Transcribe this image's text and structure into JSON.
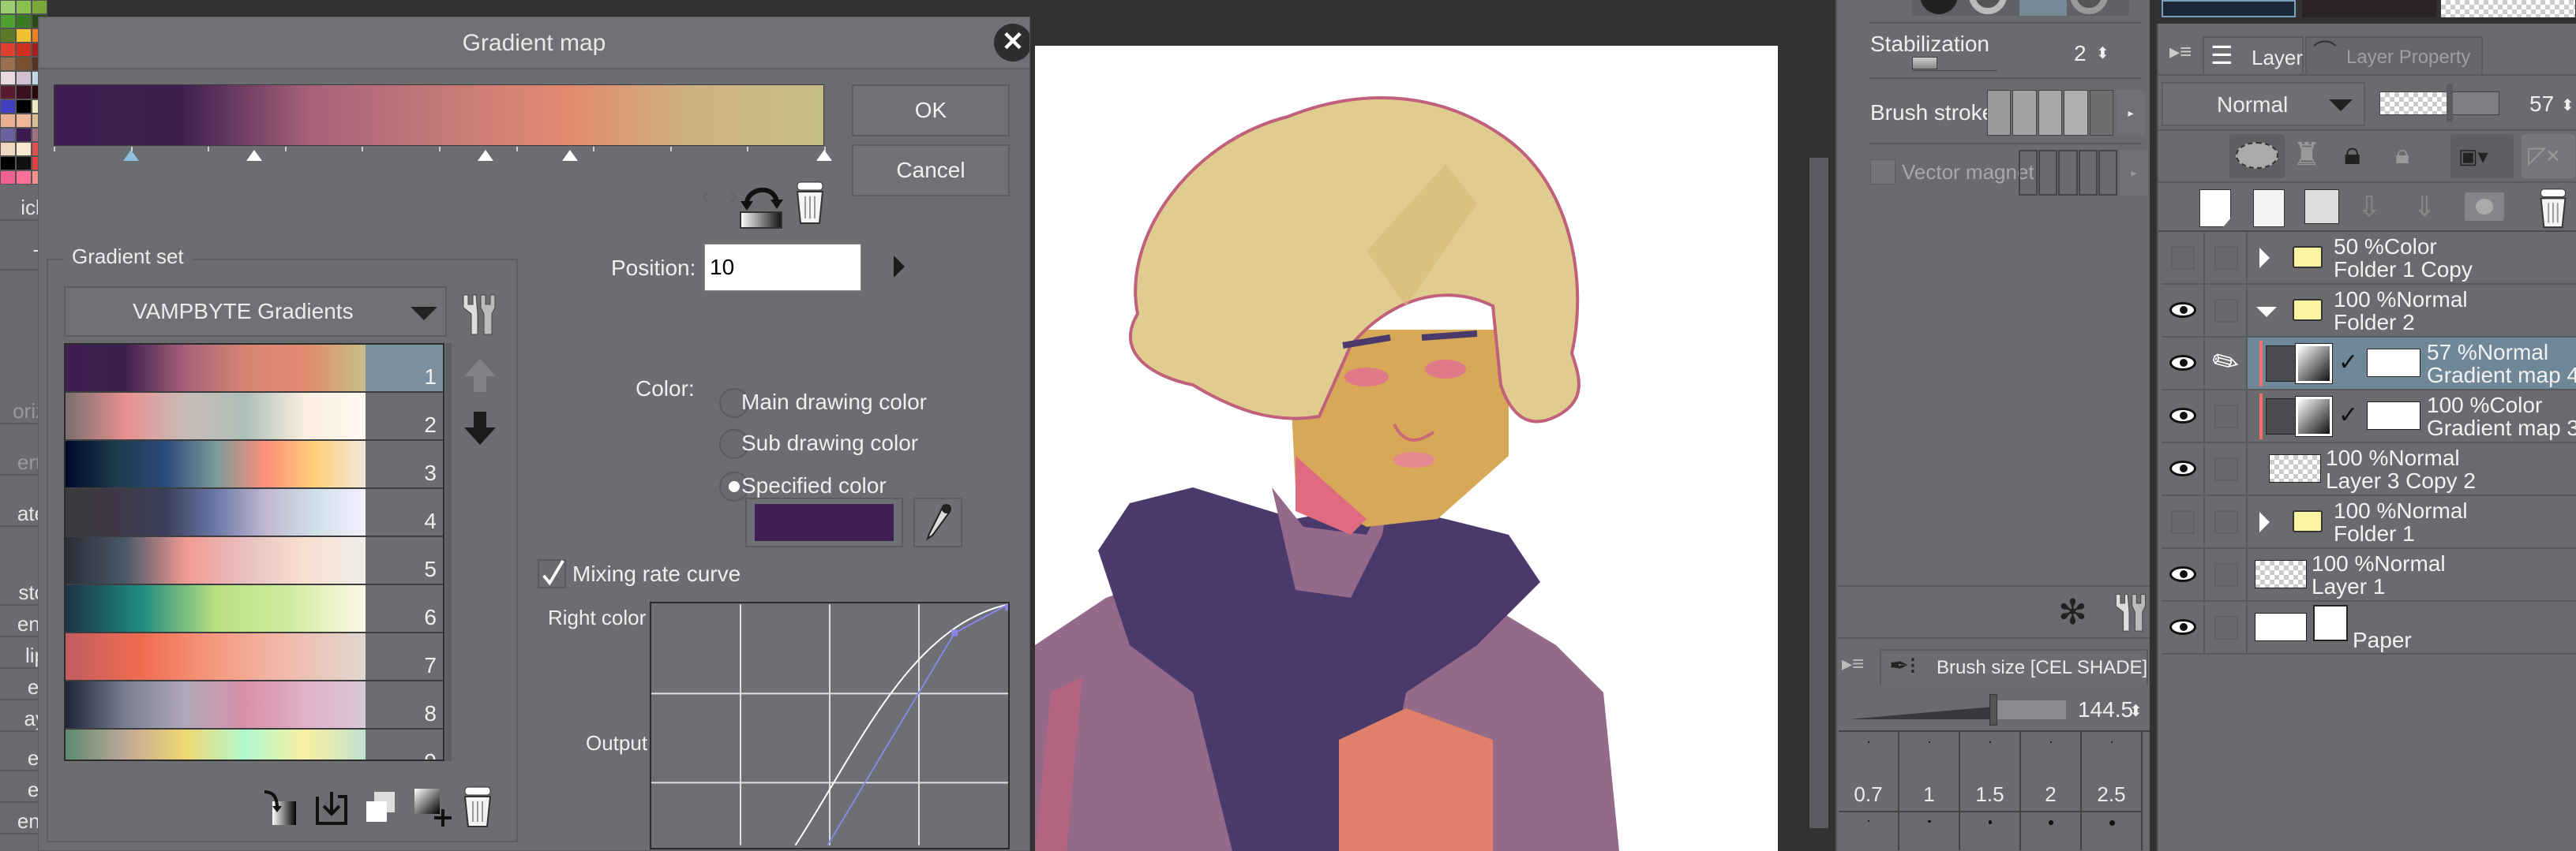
{
  "left_strip": {
    "palette_colors": [
      "#9ad070",
      "#8cc050",
      "#7aa838",
      "#4ea030",
      "#3a7a20",
      "#2a4a18",
      "#5a7a28",
      "#f0c030",
      "#f08020",
      "#e04030",
      "#d03020",
      "#a02020",
      "#9a7050",
      "#7a5030",
      "#5a3020",
      "#e8d8e0",
      "#d0c0d0",
      "#c0d8e8",
      "#5a1a30",
      "#3a1020",
      "#2a0810",
      "#4040c0",
      "#000000",
      "#f0e8c0",
      "#e8b090",
      "#f0b898",
      "#d8c090",
      "#6a60a0",
      "#3a1a50",
      "#a07080",
      "#f0d8c0",
      "#f8e8d0",
      "#e05050",
      "#000000",
      "#101010",
      "#e04040",
      "#f06090",
      "#ff7098",
      "#f09090"
    ],
    "items": [
      {
        "text": "ick",
        "dim": false
      },
      {
        "text": "T",
        "dim": false
      },
      {
        "text": "oriz",
        "dim": true
      },
      {
        "text": "erti",
        "dim": true
      },
      {
        "text": "ate",
        "dim": false
      },
      {
        "text": "sto",
        "dim": false
      },
      {
        "text": "ent",
        "dim": false
      },
      {
        "text": "lip",
        "dim": false
      },
      {
        "text": "er",
        "dim": false
      },
      {
        "text": "ay",
        "dim": false
      },
      {
        "text": "er",
        "dim": false
      },
      {
        "text": "er",
        "dim": false
      },
      {
        "text": "ent",
        "dim": false
      }
    ]
  },
  "dialog": {
    "title": "Gradient map",
    "ok_label": "OK",
    "cancel_label": "Cancel",
    "gradient": {
      "colors": [
        "#3f1f52",
        "#3e2050",
        "#a8627a",
        "#c47878",
        "#e28a70",
        "#cdb380",
        "#c6bd88"
      ],
      "stops": [
        10,
        26,
        56,
        67,
        100
      ],
      "selected_stop": 0
    },
    "gradient_set": {
      "label": "Gradient set",
      "selected": "VAMPBYTE Gradients",
      "selected_index": 0,
      "items": [
        {
          "number": "1",
          "colors": [
            "#3f1f52",
            "#3e2050",
            "#a8627a",
            "#d68472",
            "#e28a70",
            "#c6bd88"
          ]
        },
        {
          "number": "2",
          "colors": [
            "#7a6f6f",
            "#e89090",
            "#c8bcb6",
            "#aebfb8",
            "#fbefe0",
            "#fff8f0"
          ]
        },
        {
          "number": "3",
          "colors": [
            "#00092a",
            "#1c3a4a",
            "#2a4a7a",
            "#7a9a9a",
            "#ff8f7a",
            "#ffd07a",
            "#f0e8d8"
          ]
        },
        {
          "number": "4",
          "colors": [
            "#3a3a3e",
            "#3f3848",
            "#3a3f5a",
            "#6a78a8",
            "#c0b8d0",
            "#d0e0e8",
            "#f4f0ff"
          ]
        },
        {
          "number": "5",
          "colors": [
            "#2a2e38",
            "#4a5868",
            "#f09a90",
            "#e8c0c0",
            "#f8e0d0",
            "#f0ece8"
          ]
        },
        {
          "number": "6",
          "colors": [
            "#1e3348",
            "#1e8a80",
            "#b8e080",
            "#d0eca0",
            "#fff8e8"
          ]
        },
        {
          "number": "7",
          "colors": [
            "#c05c60",
            "#f06c50",
            "#f49a80",
            "#f0bcae",
            "#e0d8d0"
          ]
        },
        {
          "number": "8",
          "colors": [
            "#1c2438",
            "#7a8090",
            "#b0a8b8",
            "#d890a8",
            "#e0b0c8",
            "#d8c8d8"
          ]
        },
        {
          "number": "9",
          "colors": [
            "#5a8a70",
            "#c0a898",
            "#f0d870",
            "#b0f8d0",
            "#f8f0a0",
            "#c0e0d0"
          ]
        }
      ]
    },
    "position_label": "Position:",
    "position_value": "10",
    "color_label": "Color:",
    "color_options": [
      "Main drawing color",
      "Sub drawing color",
      "Specified color"
    ],
    "selected_color_option": 2,
    "specified_color": "#3f1f55",
    "mixing_rate_label": "Mixing rate curve",
    "mixing_rate_checked": true,
    "curve_right_color_label": "Right color",
    "curve_output_label": "Output",
    "curve_points": [
      [
        0,
        0
      ],
      [
        0.85,
        0.92
      ],
      [
        1,
        1
      ]
    ]
  },
  "tool_property": {
    "stabilization_label": "Stabilization",
    "stabilization_value": "2",
    "brush_stroke_label": "Brush stroke",
    "vector_magnet_label": "Vector magnet"
  },
  "brush_size": {
    "title": "Brush size [CEL SHADE]",
    "value": "144.5",
    "presets": [
      "0.7",
      "1",
      "1.5",
      "2",
      "2.5"
    ]
  },
  "layer_panel": {
    "tab_layer": "Layer",
    "tab_layer_property": "Layer Property",
    "blend_mode": "Normal",
    "opacity": "57",
    "layers": [
      {
        "line1": "50 %Color",
        "line2": "Folder 1 Copy",
        "visible": false,
        "type": "folder",
        "expanded": false,
        "indent": 0,
        "selected": false
      },
      {
        "line1": "100 %Normal",
        "line2": "Folder 2",
        "visible": true,
        "type": "folder",
        "expanded": true,
        "indent": 0,
        "selected": false
      },
      {
        "line1": "57 %Normal",
        "line2": "Gradient map 4",
        "visible": true,
        "type": "gradient",
        "indent": 1,
        "selected": true
      },
      {
        "line1": "100 %Color",
        "line2": "Gradient map 3",
        "visible": true,
        "type": "gradient",
        "indent": 1,
        "selected": false
      },
      {
        "line1": "100 %Normal",
        "line2": "Layer 3 Copy 2",
        "visible": true,
        "type": "raster-art",
        "indent": 1,
        "selected": false
      },
      {
        "line1": "100 %Normal",
        "line2": "Folder 1",
        "visible": false,
        "type": "folder",
        "expanded": false,
        "indent": 0,
        "selected": false
      },
      {
        "line1": "100 %Normal",
        "line2": "Layer 1",
        "visible": true,
        "type": "raster",
        "indent": 0,
        "selected": false
      },
      {
        "line1": "",
        "line2": "Paper",
        "visible": true,
        "type": "paper",
        "indent": 0,
        "selected": false
      }
    ]
  }
}
